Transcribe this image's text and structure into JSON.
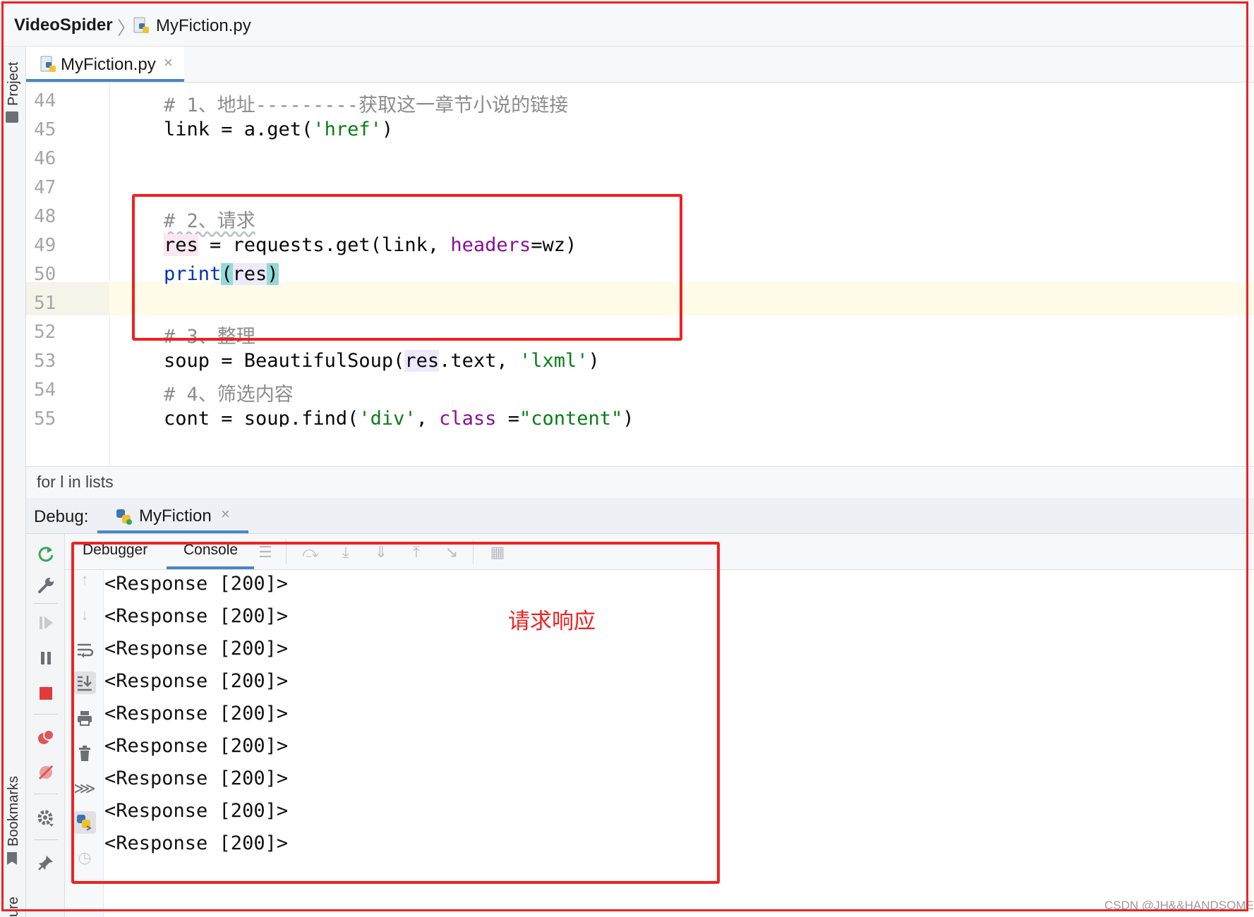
{
  "breadcrumb": {
    "project": "VideoSpider",
    "separator": "〉",
    "file": "MyFiction.py"
  },
  "left_strip": {
    "project": "Project",
    "bookmarks": "Bookmarks",
    "structure": "ure"
  },
  "editor": {
    "tab_label": "MyFiction.py",
    "tab_close": "×",
    "line_numbers": [
      "44",
      "45",
      "46",
      "47",
      "48",
      "49",
      "50",
      "51",
      "52",
      "53",
      "54",
      "55"
    ],
    "lines": {
      "l44": "# 1、地址---------获取这一章节小说的链接",
      "l45_a": "link = a.get(",
      "l45_b": "'href'",
      "l45_c": ")",
      "l48": "# 2、请求",
      "l49_a": "res",
      "l49_b": " = requests.get(link, ",
      "l49_c": "headers",
      "l49_d": "=wz)",
      "l50_a": "print",
      "l50_b": "(",
      "l50_c": "res",
      "l50_d": ")",
      "l52": "# 3、整理",
      "l53_a": "soup = BeautifulSoup(",
      "l53_b": "res",
      "l53_c": ".text, ",
      "l53_d": "'lxml'",
      "l53_e": ")",
      "l54": "# 4、筛选内容",
      "l55_a": "cont = soup.find(",
      "l55_b": "'div'",
      "l55_c": ", ",
      "l55_d": "class_",
      "l55_e": "=",
      "l55_f": "\"content\"",
      "l55_g": ")"
    },
    "code_crumb": "for l in lists"
  },
  "debug": {
    "label": "Debug:",
    "tab_label": "MyFiction",
    "tab_close": "×",
    "subtabs": {
      "debugger": "Debugger",
      "console": "Console"
    },
    "output": [
      "<Response [200]>",
      "<Response [200]>",
      "<Response [200]>",
      "<Response [200]>",
      "<Response [200]>",
      "<Response [200]>",
      "<Response [200]>",
      "<Response [200]>",
      "<Response [200]>"
    ]
  },
  "annotation": "请求响应",
  "watermark": "CSDN @JH&&HANDSOME",
  "colors": {
    "highlight_box": "#ee2222",
    "accent": "#4a86c8",
    "comment": "#8c8c8c",
    "string": "#067d17",
    "keyword_arg": "#871094"
  }
}
